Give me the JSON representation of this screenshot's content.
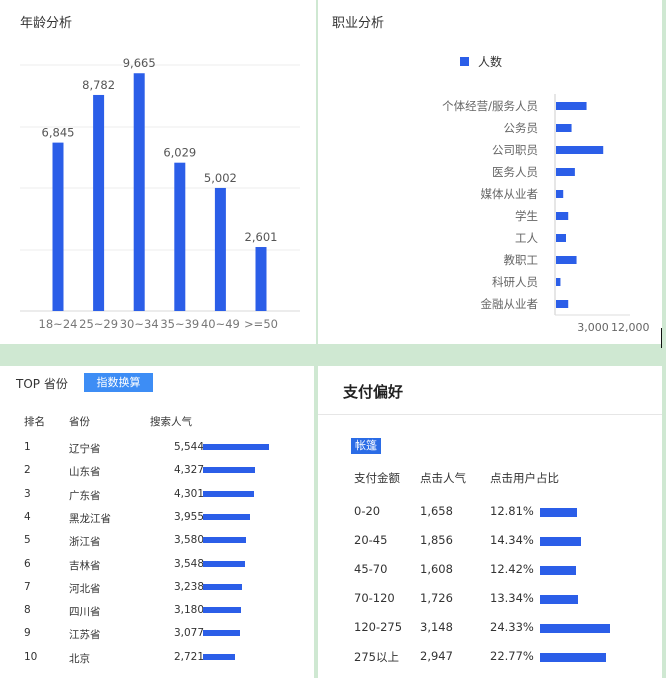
{
  "colors": {
    "accent": "#2b5ee8",
    "button": "#3d8df5",
    "background": "#cfe8d2"
  },
  "age": {
    "title": "年龄分析",
    "chart_data": {
      "type": "bar",
      "categories": [
        "18~24",
        "25~29",
        "30~34",
        "35~39",
        "40~49",
        ">=50"
      ],
      "values": [
        6845,
        8782,
        9665,
        6029,
        5002,
        2601
      ],
      "value_labels": [
        "6,845",
        "8,782",
        "9,665",
        "6,029",
        "5,002",
        "2,601"
      ],
      "ylim": [
        0,
        10000
      ],
      "grid": true
    }
  },
  "job": {
    "title": "职业分析",
    "chart_data": {
      "type": "bar",
      "orientation": "horizontal",
      "legend": "人数",
      "legend_position": "top",
      "categories": [
        "个体经营/服务人员",
        "公务员",
        "公司职员",
        "医务人员",
        "媒体从业者",
        "学生",
        "工人",
        "教职工",
        "科研人员",
        "金融从业者"
      ],
      "values": [
        5500,
        2800,
        8500,
        3400,
        1300,
        2200,
        1800,
        3700,
        800,
        2200
      ],
      "xticks": [
        "3,000",
        "12,000"
      ],
      "xlim": [
        0,
        13500
      ]
    }
  },
  "province": {
    "title": "TOP 省份",
    "button_label": "指数换算",
    "headers": [
      "排名",
      "省份",
      "搜索人气"
    ],
    "max": 5544,
    "rows": [
      {
        "rank": "1",
        "name": "辽宁省",
        "value_text": "5,544",
        "value": 5544
      },
      {
        "rank": "2",
        "name": "山东省",
        "value_text": "4,327",
        "value": 4327
      },
      {
        "rank": "3",
        "name": "广东省",
        "value_text": "4,301",
        "value": 4301
      },
      {
        "rank": "4",
        "name": "黑龙江省",
        "value_text": "3,955",
        "value": 3955
      },
      {
        "rank": "5",
        "name": "浙江省",
        "value_text": "3,580",
        "value": 3580
      },
      {
        "rank": "6",
        "name": "吉林省",
        "value_text": "3,548",
        "value": 3548
      },
      {
        "rank": "7",
        "name": "河北省",
        "value_text": "3,238",
        "value": 3238
      },
      {
        "rank": "8",
        "name": "四川省",
        "value_text": "3,180",
        "value": 3180
      },
      {
        "rank": "9",
        "name": "江苏省",
        "value_text": "3,077",
        "value": 3077
      },
      {
        "rank": "10",
        "name": "北京",
        "value_text": "2,721",
        "value": 2721
      }
    ]
  },
  "payment": {
    "title": "支付偏好",
    "tag": "帐篷",
    "headers": [
      "支付金额",
      "点击人气",
      "点击用户占比"
    ],
    "max": 24.33,
    "rows": [
      {
        "range": "0-20",
        "clicks": "1,658",
        "pct_text": "12.81%",
        "pct": 12.81
      },
      {
        "range": "20-45",
        "clicks": "1,856",
        "pct_text": "14.34%",
        "pct": 14.34
      },
      {
        "range": "45-70",
        "clicks": "1,608",
        "pct_text": "12.42%",
        "pct": 12.42
      },
      {
        "range": "70-120",
        "clicks": "1,726",
        "pct_text": "13.34%",
        "pct": 13.34
      },
      {
        "range": "120-275",
        "clicks": "3,148",
        "pct_text": "24.33%",
        "pct": 24.33
      },
      {
        "range": "275以上",
        "clicks": "2,947",
        "pct_text": "22.77%",
        "pct": 22.77
      }
    ]
  }
}
